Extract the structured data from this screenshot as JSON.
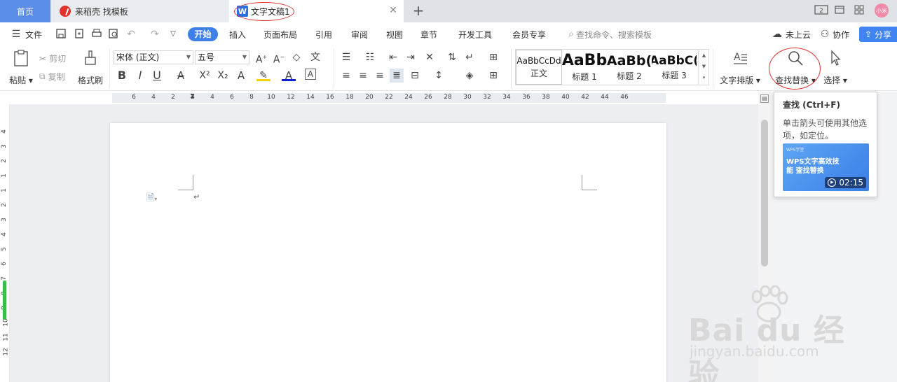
{
  "tabs": {
    "home": "首页",
    "daoke": "来稻壳 找模板",
    "doc": "文字文稿1",
    "doc_icon_letter": "W",
    "close": "✕",
    "new": "+"
  },
  "window": {
    "avatar_text": "小米",
    "layout_label": "2"
  },
  "menu": {
    "file": "文件",
    "items": [
      "开始",
      "插入",
      "页面布局",
      "引用",
      "审阅",
      "视图",
      "章节",
      "开发工具",
      "会员专享"
    ],
    "search_placeholder": "查找命令、搜索模板",
    "cloud": "未上云",
    "collab": "协作",
    "share": "分享"
  },
  "ribbon": {
    "paste": "粘贴",
    "cut": "剪切",
    "copy": "复制",
    "format_painter": "格式刷",
    "font_name": "宋体 (正文)",
    "font_size": "五号",
    "styles": [
      {
        "sample": "AaBbCcDd",
        "label": "正文"
      },
      {
        "sample": "AaBb",
        "label": "标题 1"
      },
      {
        "sample": "AaBb(",
        "label": "标题 2"
      },
      {
        "sample": "AaBbC(",
        "label": "标题 3"
      }
    ],
    "text_layout": "文字排版",
    "find_replace": "查找替换",
    "select": "选择"
  },
  "ruler": {
    "h_ticks": [
      "6",
      "4",
      "2",
      "2",
      "4",
      "6",
      "8",
      "10",
      "12",
      "14",
      "16",
      "18",
      "20",
      "22",
      "24",
      "26",
      "28",
      "30",
      "32",
      "34",
      "36",
      "38",
      "40",
      "42",
      "44",
      "46"
    ],
    "v_ticks": [
      "4",
      "3",
      "2",
      "1",
      "1",
      "2",
      "3",
      "4",
      "5",
      "6",
      "7",
      "8",
      "9",
      "10",
      "11",
      "12"
    ]
  },
  "tooltip": {
    "title": "查找 (Ctrl+F)",
    "desc": "单击箭头可使用其他选项，如定位。",
    "video_brand": "WPS学堂",
    "video_title": "WPS文字高效技能 查找替换",
    "video_time": "02:15"
  },
  "document": {
    "paragraph_mark": "↵"
  },
  "watermark": {
    "main": "Bai du 经验",
    "sub": "jingyan.baidu.com"
  },
  "colors": {
    "accent": "#3f7fe8",
    "home_tab": "#5b8ee8",
    "highlight_ring": "#e03030"
  }
}
